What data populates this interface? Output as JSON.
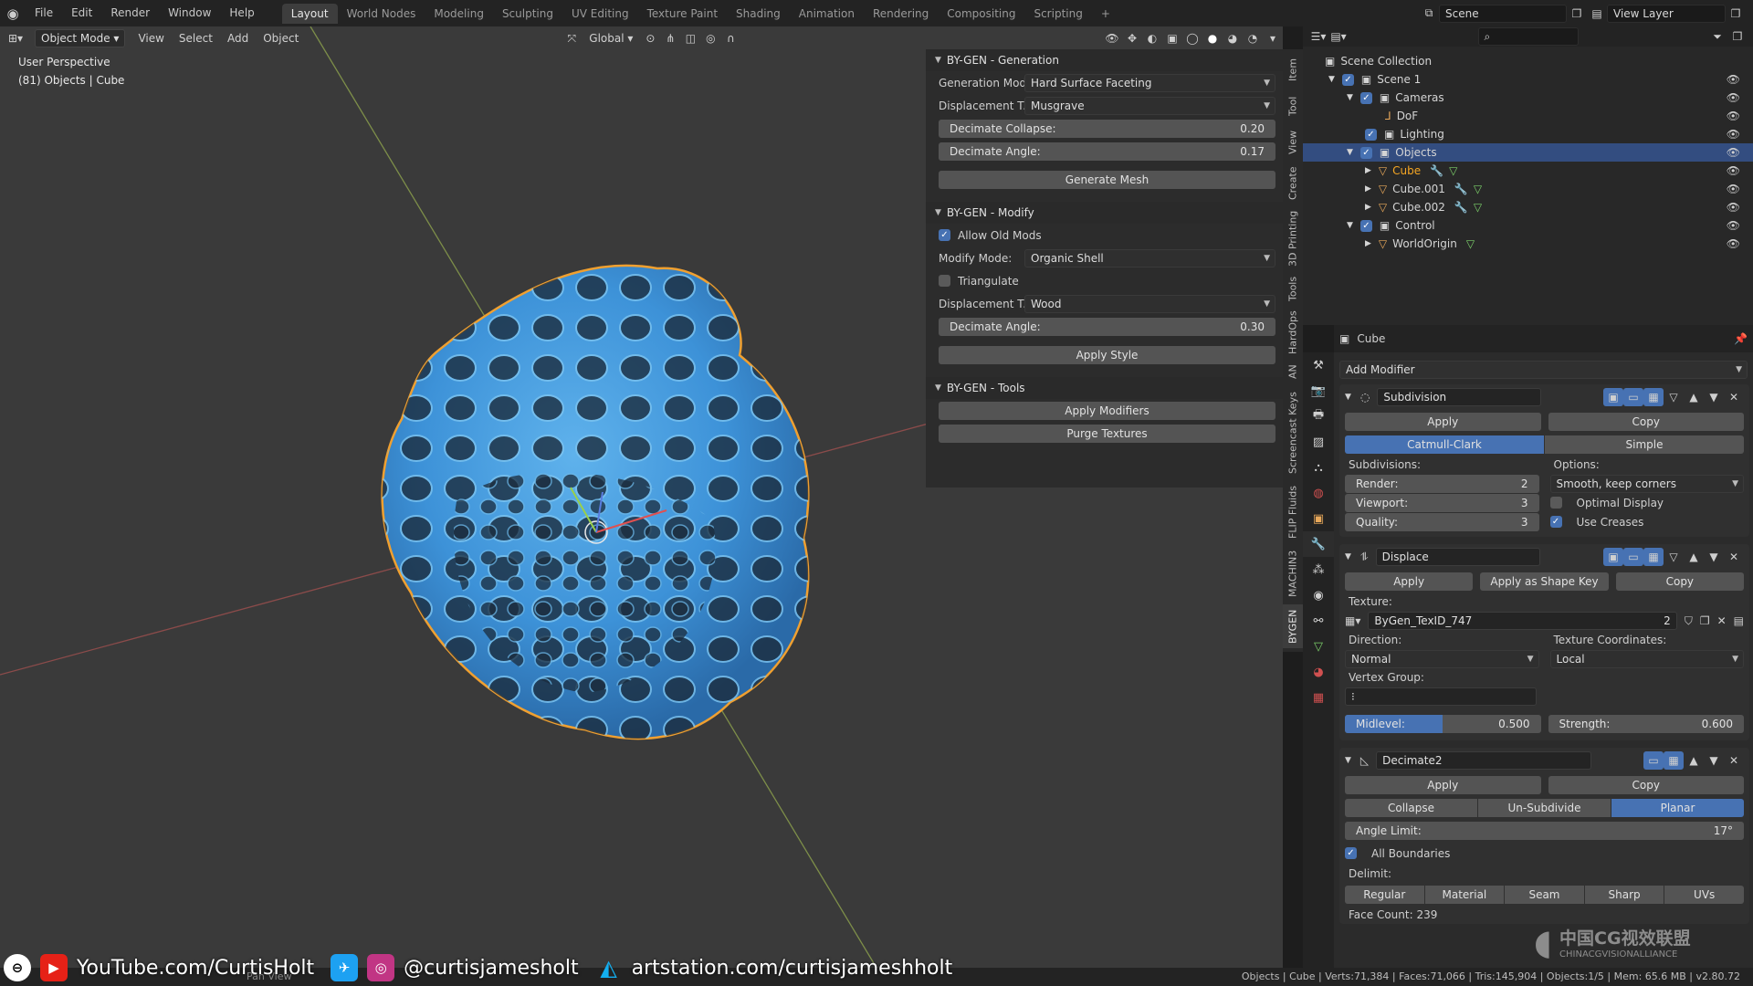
{
  "menu": [
    "File",
    "Edit",
    "Render",
    "Window",
    "Help"
  ],
  "workspaces": [
    {
      "label": "Layout",
      "active": true
    },
    {
      "label": "World Nodes",
      "active": false
    },
    {
      "label": "Modeling",
      "active": false
    },
    {
      "label": "Sculpting",
      "active": false
    },
    {
      "label": "UV Editing",
      "active": false
    },
    {
      "label": "Texture Paint",
      "active": false
    },
    {
      "label": "Shading",
      "active": false
    },
    {
      "label": "Animation",
      "active": false
    },
    {
      "label": "Rendering",
      "active": false
    },
    {
      "label": "Compositing",
      "active": false
    },
    {
      "label": "Scripting",
      "active": false
    }
  ],
  "add_workspace": "+",
  "scene": "Scene",
  "view_layer": "View Layer",
  "viewport": {
    "mode": "Object Mode",
    "view": "View",
    "select": "Select",
    "add": "Add",
    "object": "Object",
    "transform_orientation": "Global",
    "perspective_label": "User Perspective",
    "context_label": "(81) Objects | Cube"
  },
  "npanel": {
    "generation": {
      "title": "BY-GEN - Generation",
      "gen_mode_label": "Generation Mod...",
      "gen_mode_value": "Hard Surface Faceting",
      "disp_label": "Displacement T...",
      "disp_value": "Musgrave",
      "decimate_collapse_label": "Decimate Collapse:",
      "decimate_collapse_value": "0.20",
      "decimate_angle_label": "Decimate Angle:",
      "decimate_angle_value": "0.17",
      "generate_button": "Generate Mesh"
    },
    "modify": {
      "title": "BY-GEN - Modify",
      "allow_old_mods": "Allow Old Mods",
      "modify_mode_label": "Modify Mode:",
      "modify_mode_value": "Organic Shell",
      "triangulate": "Triangulate",
      "disp_label": "Displacement T...",
      "disp_value": "Wood",
      "decimate_angle_label": "Decimate Angle:",
      "decimate_angle_value": "0.30",
      "apply_style": "Apply Style"
    },
    "tools": {
      "title": "BY-GEN - Tools",
      "apply_modifiers": "Apply Modifiers",
      "purge_textures": "Purge Textures"
    }
  },
  "vtabs": [
    "Item",
    "Tool",
    "View",
    "Create",
    "3D Printing",
    "Tools",
    "HardOps",
    "AN",
    "Screencast Keys",
    "FLIP Fluids",
    "MACHIN3",
    "BYGEN"
  ],
  "outliner": {
    "rows": [
      {
        "label": "Scene Collection",
        "indent": 0
      },
      {
        "label": "Scene 1",
        "indent": 1
      },
      {
        "label": "Cameras",
        "indent": 2
      },
      {
        "label": "DoF",
        "indent": 3
      },
      {
        "label": "Lighting",
        "indent": 2
      },
      {
        "label": "Objects",
        "indent": 2,
        "selected": true
      },
      {
        "label": "Cube",
        "indent": 3,
        "active": true
      },
      {
        "label": "Cube.001",
        "indent": 3
      },
      {
        "label": "Cube.002",
        "indent": 3
      },
      {
        "label": "Control",
        "indent": 2
      },
      {
        "label": "WorldOrigin",
        "indent": 3
      }
    ]
  },
  "properties": {
    "object_name": "Cube",
    "add_modifier": "Add Modifier",
    "subdivision": {
      "name": "Subdivision",
      "apply": "Apply",
      "copy": "Copy",
      "catmull": "Catmull-Clark",
      "simple": "Simple",
      "subdivisions_label": "Subdivisions:",
      "options_label": "Options:",
      "render_label": "Render:",
      "render_value": "2",
      "viewport_label": "Viewport:",
      "viewport_value": "3",
      "quality_label": "Quality:",
      "quality_value": "3",
      "uv_smooth": "Smooth, keep corners",
      "optimal_display": "Optimal Display",
      "use_creases": "Use Creases"
    },
    "displace": {
      "name": "Displace",
      "apply": "Apply",
      "apply_shape": "Apply as Shape Key",
      "copy": "Copy",
      "texture_label": "Texture:",
      "texture_value": "ByGen_TexID_747",
      "texture_users": "2",
      "direction_label": "Direction:",
      "direction_value": "Normal",
      "texcoords_label": "Texture Coordinates:",
      "texcoords_value": "Local",
      "vgroup_label": "Vertex Group:",
      "midlevel_label": "Midlevel:",
      "midlevel_value": "0.500",
      "midlevel_fraction": 0.5,
      "strength_label": "Strength:",
      "strength_value": "0.600"
    },
    "decimate": {
      "name": "Decimate2",
      "apply": "Apply",
      "copy": "Copy",
      "collapse": "Collapse",
      "unsubdivide": "Un-Subdivide",
      "planar": "Planar",
      "angle_label": "Angle Limit:",
      "angle_value": "17°",
      "all_boundaries": "All Boundaries",
      "delimit_label": "Delimit:",
      "delimit": [
        "Regular",
        "Material",
        "Seam",
        "Sharp",
        "UVs"
      ],
      "face_count": "Face Count: 239"
    }
  },
  "status": "Objects | Cube | Verts:71,384 | Faces:71,066 | Tris:145,904 | Objects:1/5 | Mem: 65.6 MB | v2.80.72",
  "overlay": {
    "youtube": "YouTube.com/CurtisHolt",
    "handle": "@curtisjamesholt",
    "artstation": "artstation.com/curtisjameshholt",
    "pan_view": "Pan View",
    "watermark_cn": "中国CG视效联盟",
    "watermark_en": "CHINACGVISIONALLIANCE"
  },
  "colors": {
    "accent": "#4772b3",
    "selection": "#334d80",
    "active_object": "#f5a623",
    "mesh": "#3d92d8",
    "outline": "#f0a030"
  }
}
